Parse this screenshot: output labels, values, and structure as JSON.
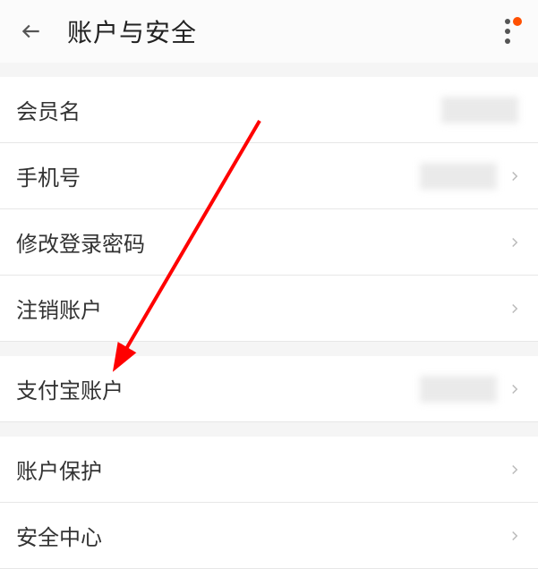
{
  "header": {
    "title": "账户与安全"
  },
  "sections": [
    {
      "items": [
        {
          "label": "会员名",
          "has_value": true,
          "has_chevron": false
        },
        {
          "label": "手机号",
          "has_value": true,
          "has_chevron": true
        },
        {
          "label": "修改登录密码",
          "has_value": false,
          "has_chevron": true
        },
        {
          "label": "注销账户",
          "has_value": false,
          "has_chevron": true
        }
      ]
    },
    {
      "items": [
        {
          "label": "支付宝账户",
          "has_value": true,
          "has_chevron": true
        }
      ]
    },
    {
      "items": [
        {
          "label": "账户保护",
          "has_value": false,
          "has_chevron": true
        },
        {
          "label": "安全中心",
          "has_value": false,
          "has_chevron": true
        }
      ]
    }
  ],
  "annotation": {
    "arrow_color": "#ff0000"
  }
}
